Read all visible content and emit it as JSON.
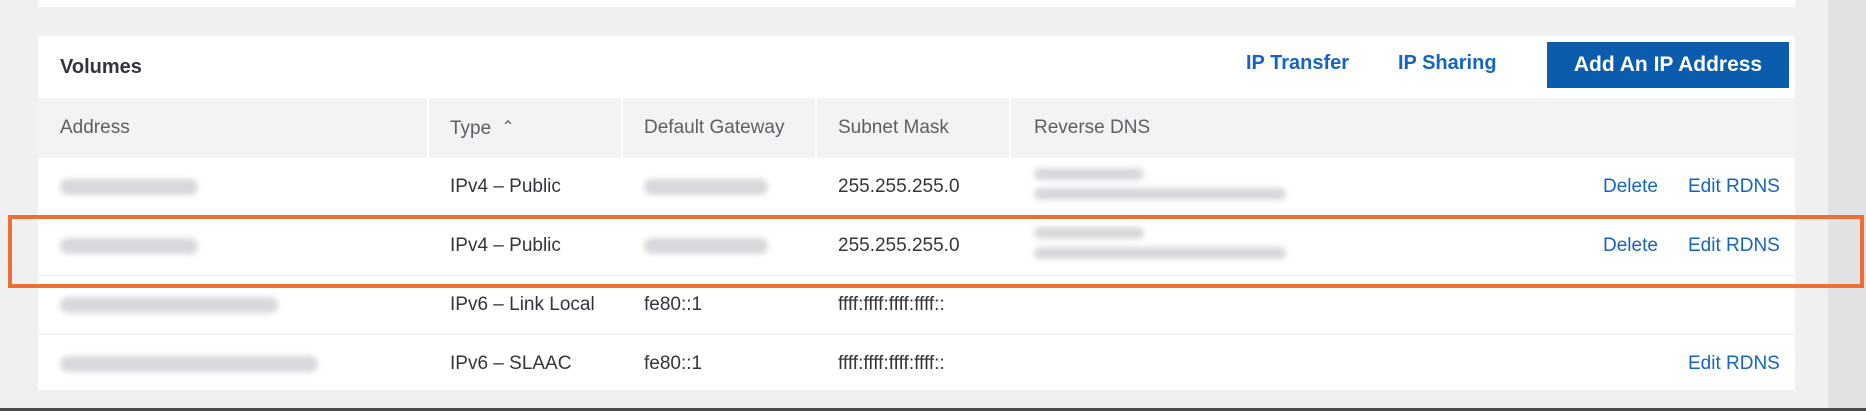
{
  "section": {
    "title": "Volumes",
    "links": [
      "IP Transfer",
      "IP Sharing"
    ],
    "add_button": "Add An IP Address"
  },
  "table": {
    "columns": [
      "Address",
      "Type",
      "Default Gateway",
      "Subnet Mask",
      "Reverse DNS"
    ],
    "sort": {
      "column": "Type",
      "direction": "ascending",
      "icon": "chevron-up-icon"
    },
    "rows": [
      {
        "address": "",
        "address_redacted": true,
        "type": "IPv4 – Public",
        "gateway": "",
        "gateway_redacted": true,
        "subnet": "255.255.255.0",
        "rdns_redacted": true,
        "actions": [
          "Delete",
          "Edit RDNS"
        ]
      },
      {
        "address": "",
        "address_redacted": true,
        "type": "IPv4 – Public",
        "gateway": "",
        "gateway_redacted": true,
        "subnet": "255.255.255.0",
        "rdns_redacted": true,
        "actions": [
          "Delete",
          "Edit RDNS"
        ],
        "highlighted": true
      },
      {
        "address": "",
        "address_redacted": true,
        "type": "IPv6 – Link Local",
        "gateway": "fe80::1",
        "subnet": "ffff:ffff:ffff:ffff::",
        "rdns_redacted": false,
        "actions": []
      },
      {
        "address": "",
        "address_redacted": true,
        "type": "IPv6 – SLAAC",
        "gateway": "fe80::1",
        "subnet": "ffff:ffff:ffff:ffff::",
        "rdns_redacted": false,
        "actions": [
          "Edit RDNS"
        ]
      }
    ]
  },
  "colors": {
    "accent": "#1565c0",
    "button": "#0b5cad",
    "highlight": "#ec6f35"
  }
}
